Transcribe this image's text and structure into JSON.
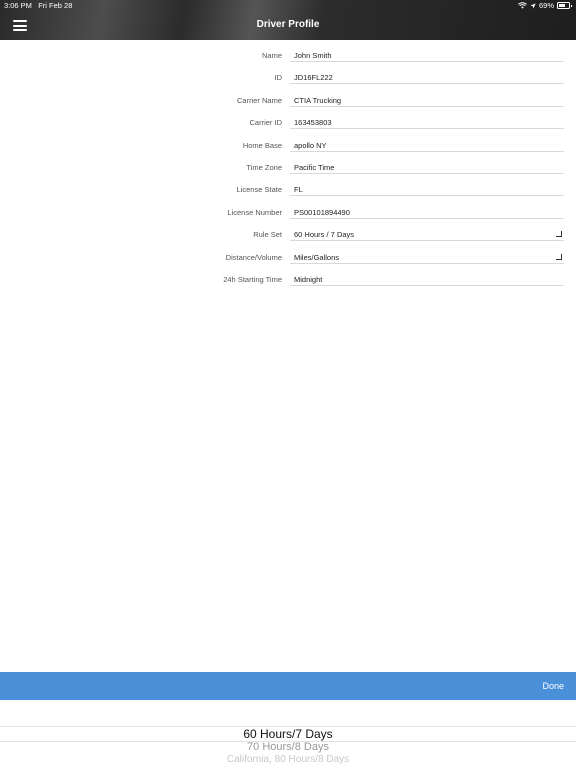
{
  "status_bar": {
    "time": "3:06 PM",
    "date": "Fri Feb 28",
    "battery": "69%",
    "battery_level": 0.69
  },
  "header": {
    "title": "Driver Profile",
    "menu_icon": "hamburger-menu-icon"
  },
  "fields": [
    {
      "label": "Name",
      "value": "John Smith",
      "picker": false
    },
    {
      "label": "ID",
      "value": "JD16FL222",
      "picker": false
    },
    {
      "label": "Carrier Name",
      "value": "CTIA Trucking",
      "picker": false
    },
    {
      "label": "Carrier ID",
      "value": "163453803",
      "picker": false
    },
    {
      "label": "Home Base",
      "value": "apollo NY",
      "picker": false
    },
    {
      "label": "Time Zone",
      "value": "Pacific Time",
      "picker": false
    },
    {
      "label": "License State",
      "value": "FL",
      "picker": false
    },
    {
      "label": "License Number",
      "value": "PS00101894490",
      "picker": false
    },
    {
      "label": "Rule Set",
      "value": "60 Hours / 7 Days",
      "picker": true
    },
    {
      "label": "Distance/Volume",
      "value": "Miles/Gallons",
      "picker": true
    },
    {
      "label": "24h Starting Time",
      "value": "Midnight",
      "picker": false
    }
  ],
  "picker": {
    "done_label": "Done",
    "options": [
      "60 Hours/7 Days",
      "70 Hours/8 Days",
      "California, 80 Hours/8 Days"
    ],
    "selected": "60 Hours/7 Days"
  },
  "colors": {
    "accent": "#4a90d9"
  }
}
